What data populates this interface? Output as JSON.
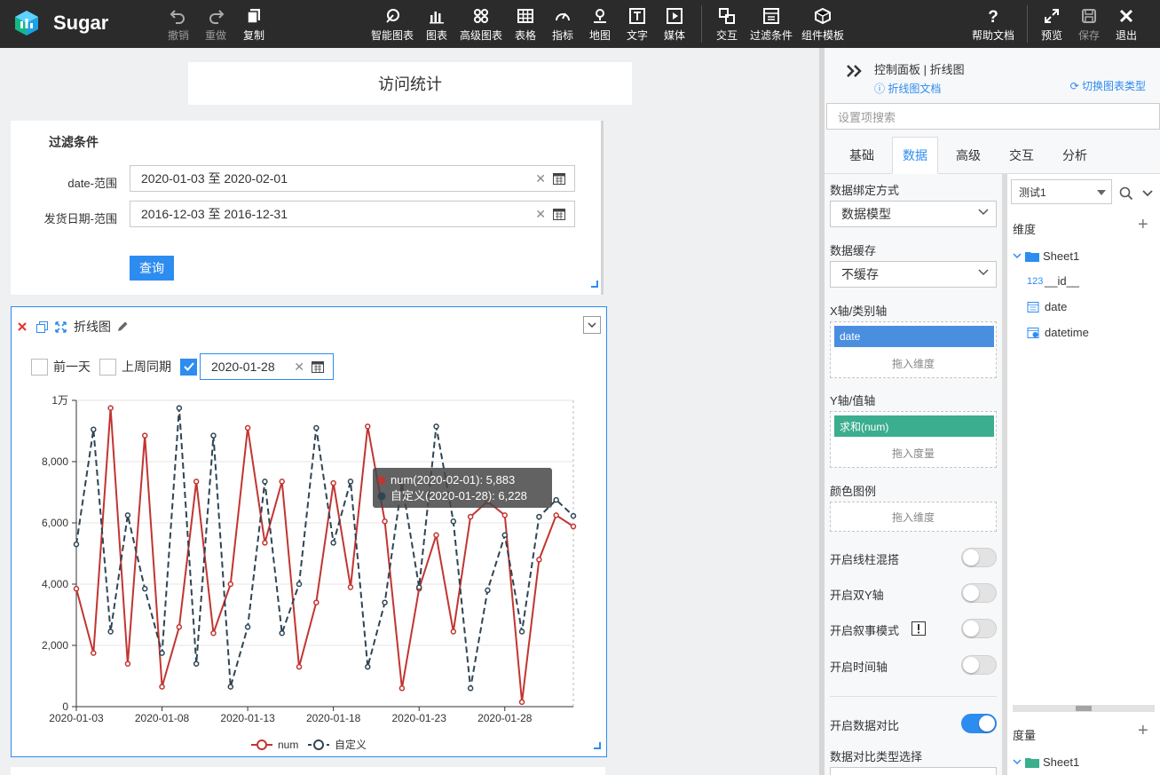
{
  "app": {
    "name": "Sugar"
  },
  "toolbar": {
    "left": [
      {
        "label": "撤销",
        "icon": "undo-icon"
      },
      {
        "label": "重做",
        "icon": "redo-icon"
      },
      {
        "label": "复制",
        "icon": "copy-icon"
      }
    ],
    "center": [
      {
        "label": "智能图表",
        "icon": "smart-chart-icon"
      },
      {
        "label": "图表",
        "icon": "bar-chart-icon"
      },
      {
        "label": "高级图表",
        "icon": "advanced-chart-icon"
      },
      {
        "label": "表格",
        "icon": "table-icon"
      },
      {
        "label": "指标",
        "icon": "gauge-icon"
      },
      {
        "label": "地图",
        "icon": "map-pin-icon"
      },
      {
        "label": "文字",
        "icon": "text-icon"
      },
      {
        "label": "媒体",
        "icon": "media-icon"
      },
      {
        "label": "交互",
        "icon": "interaction-icon"
      },
      {
        "label": "过滤条件",
        "icon": "filter-icon"
      },
      {
        "label": "组件模板",
        "icon": "template-icon"
      }
    ],
    "right": [
      {
        "label": "帮助文档",
        "icon": "help-icon"
      },
      {
        "label": "预览",
        "icon": "preview-icon"
      },
      {
        "label": "保存",
        "icon": "save-icon"
      },
      {
        "label": "退出",
        "icon": "close-icon"
      }
    ]
  },
  "page_title": "访问统计",
  "filter_panel": {
    "title": "过滤条件",
    "fields": [
      {
        "label": "date-范围",
        "value": "2020-01-03 至 2020-02-01"
      },
      {
        "label": "发货日期-范围",
        "value": "2016-12-03 至 2016-12-31"
      }
    ],
    "query_label": "查询"
  },
  "chart_panel": {
    "title": "折线图",
    "options": [
      {
        "label": "前一天",
        "checked": false
      },
      {
        "label": "上周同期",
        "checked": false
      }
    ],
    "custom_checked": true,
    "custom_date": "2020-01-28",
    "tooltip": {
      "line1": "num(2020-02-01): 5,883",
      "line2": "自定义(2020-01-28): 6,228"
    }
  },
  "chart_data": {
    "type": "line",
    "x": [
      "2020-01-03",
      "2020-01-04",
      "2020-01-05",
      "2020-01-06",
      "2020-01-07",
      "2020-01-08",
      "2020-01-09",
      "2020-01-10",
      "2020-01-11",
      "2020-01-12",
      "2020-01-13",
      "2020-01-14",
      "2020-01-15",
      "2020-01-16",
      "2020-01-17",
      "2020-01-18",
      "2020-01-19",
      "2020-01-20",
      "2020-01-21",
      "2020-01-22",
      "2020-01-23",
      "2020-01-24",
      "2020-01-25",
      "2020-01-26",
      "2020-01-27",
      "2020-01-28",
      "2020-01-29",
      "2020-01-30",
      "2020-01-31",
      "2020-02-01"
    ],
    "tick_labels": [
      "2020-01-03",
      "2020-01-08",
      "2020-01-13",
      "2020-01-18",
      "2020-01-23",
      "2020-01-28"
    ],
    "y_ticks": [
      "0",
      "2,000",
      "4,000",
      "6,000",
      "8,000",
      "1万"
    ],
    "ylim": [
      0,
      10000
    ],
    "series": [
      {
        "name": "num",
        "color": "#c23531",
        "dashed": false,
        "values": [
          3850,
          1750,
          9750,
          1400,
          8850,
          650,
          2600,
          7350,
          2400,
          4000,
          9100,
          5350,
          7350,
          1300,
          3400,
          7300,
          3900,
          9150,
          6050,
          600,
          3850,
          5600,
          2450,
          6200,
          6700,
          6250,
          150,
          4800,
          6250,
          5883
        ]
      },
      {
        "name": "自定义",
        "color": "#2f4554",
        "dashed": true,
        "values": [
          5300,
          9050,
          2450,
          6250,
          3850,
          1750,
          9750,
          1400,
          8850,
          650,
          2600,
          7350,
          2400,
          4000,
          9100,
          5350,
          7350,
          1300,
          3400,
          7300,
          3900,
          9150,
          6050,
          600,
          3800,
          5600,
          2450,
          6200,
          6750,
          6228
        ]
      }
    ],
    "legend": "bottom-center",
    "grid": true
  },
  "right_panel": {
    "title": "控制面板 | 折线图",
    "doc_link": "折线图文档",
    "switch_link": "切换图表类型",
    "search_placeholder": "设置项搜索",
    "tabs": [
      "基础",
      "数据",
      "高级",
      "交互",
      "分析"
    ],
    "active_tab": "数据",
    "binding_label": "数据绑定方式",
    "binding_value": "数据模型",
    "cache_label": "数据缓存",
    "cache_value": "不缓存",
    "x_axis_label": "X轴/类别轴",
    "x_axis_pill": "date",
    "x_axis_hint": "拖入维度",
    "y_axis_label": "Y轴/值轴",
    "y_axis_pill": "求和(num)",
    "y_axis_hint": "拖入度量",
    "legend_label": "颜色图例",
    "legend_hint": "拖入维度",
    "toggles": [
      {
        "label": "开启线柱混搭",
        "on": false
      },
      {
        "label": "开启双Y轴",
        "on": false
      },
      {
        "label": "开启叙事模式",
        "on": false
      },
      {
        "label": "开启时间轴",
        "on": false
      }
    ],
    "compare_label": "开启数据对比",
    "compare_on": true,
    "compare_type_label": "数据对比类型选择",
    "model_name": "测试1",
    "dimension_label": "维度",
    "sheet_name": "Sheet1",
    "fields": [
      {
        "type": "123",
        "name": "__id__"
      },
      {
        "type": "date",
        "name": "date"
      },
      {
        "type": "datetime",
        "name": "datetime"
      }
    ],
    "measure_label": "度量",
    "measure_sheet": "Sheet1"
  }
}
